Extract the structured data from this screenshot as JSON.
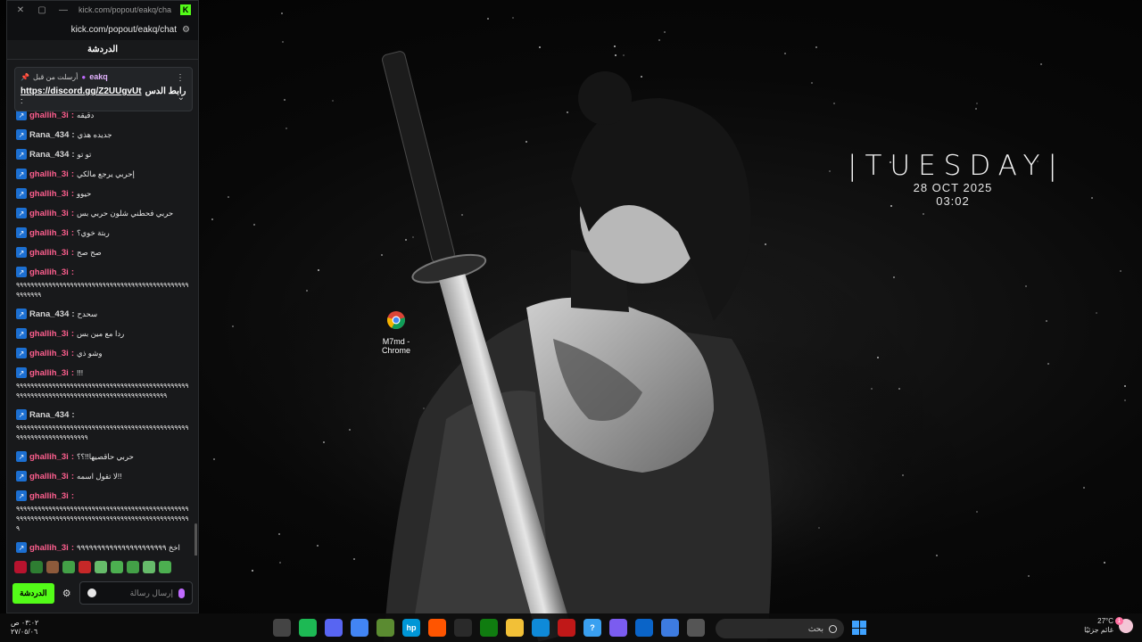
{
  "desktop": {
    "widget": {
      "day": "|TUESDAY|",
      "date": "28 OCT 2025",
      "time": "03:02"
    },
    "icon": {
      "label_line1": "M7md -",
      "label_line2": "Chrome",
      "icon": "chrome-icon"
    }
  },
  "chat_window": {
    "title_url": "kick.com/popout/eakq/chat",
    "address": "kick.com/popout/eakq/chat",
    "header": "الدردشة",
    "pinned": {
      "sent_by": "أرسلت من قبل",
      "author": "eakq",
      "link": "https://discord.gg/Z2UUgvUt",
      "text": "رابط الدس",
      "tail": ":"
    },
    "messages": [
      {
        "user": "ghallih_3i",
        "color": "pink",
        "text": "دقيقه"
      },
      {
        "user": "Rana_434",
        "color": "gray",
        "text": "جديده هذي"
      },
      {
        "user": "Rana_434",
        "color": "gray",
        "text": "تو تو"
      },
      {
        "user": "ghallih_3i",
        "color": "pink",
        "text": "إحربي يرجع مالكي"
      },
      {
        "user": "ghallih_3i",
        "color": "pink",
        "text": "حيوو"
      },
      {
        "user": "ghallih_3i",
        "color": "pink",
        "text": "حربي فحطني شلون حربي بس"
      },
      {
        "user": "ghallih_3i",
        "color": "pink",
        "text": "ربتة خوي؟"
      },
      {
        "user": "ghallih_3i",
        "color": "pink",
        "text": "صح صح"
      },
      {
        "user": "ghallih_3i",
        "color": "pink",
        "text": "",
        "long": "٩٩٩٩٩٩٩٩٩٩٩٩٩٩٩٩٩٩٩٩٩٩٩٩٩٩٩٩٩٩٩٩٩٩٩٩٩٩٩٩٩٩٩٩٩٩٩٩٩٩٩٩٩٩٩"
      },
      {
        "user": "Rana_434",
        "color": "gray",
        "text": "سحدح"
      },
      {
        "user": "ghallih_3i",
        "color": "pink",
        "text": "ردا مع مين بس"
      },
      {
        "user": "ghallih_3i",
        "color": "pink",
        "text": "وشو ذي"
      },
      {
        "user": "ghallih_3i",
        "color": "pink",
        "text": "!!!",
        "long": "٩٩٩٩٩٩٩٩٩٩٩٩٩٩٩٩٩٩٩٩٩٩٩٩٩٩٩٩٩٩٩٩٩٩٩٩٩٩٩٩٩٩٩٩٩٩٩٩٩٩٩٩٩٩٩٩٩٩٩٩٩٩٩٩٩٩٩٩٩٩٩٩٩٩٩٩٩٩٩٩٩٩٩٩٩٩٩٩٩٩"
      },
      {
        "user": "Rana_434",
        "color": "gray",
        "text": "",
        "long": "٩٩٩٩٩٩٩٩٩٩٩٩٩٩٩٩٩٩٩٩٩٩٩٩٩٩٩٩٩٩٩٩٩٩٩٩٩٩٩٩٩٩٩٩٩٩٩٩٩٩٩٩٩٩٩٩٩٩٩٩٩٩٩٩٩٩٩٩"
      },
      {
        "user": "ghallih_3i",
        "color": "pink",
        "text": "حربي حاقصيها!!؟؟"
      },
      {
        "user": "ghallih_3i",
        "color": "pink",
        "text": "لا تقول اسمه!!"
      },
      {
        "user": "ghallih_3i",
        "color": "pink",
        "text": "",
        "long": "٩٩٩٩٩٩٩٩٩٩٩٩٩٩٩٩٩٩٩٩٩٩٩٩٩٩٩٩٩٩٩٩٩٩٩٩٩٩٩٩٩٩٩٩٩٩٩٩٩٩٩٩٩٩٩٩٩٩٩٩٩٩٩٩٩٩٩٩٩٩٩٩٩٩٩٩٩٩٩٩٩٩٩٩٩٩٩٩٩٩٩٩٩٩٩٩٩"
      },
      {
        "user": "ghallih_3i",
        "color": "pink",
        "text": "اخخ ٩٩٩٩٩٩٩٩٩٩٩٩٩٩٩٩٩٩٩٩٩٩"
      }
    ],
    "input_placeholder": "إرسال رسالة",
    "send_label": "الدردشة"
  },
  "taskbar": {
    "time": "٠٣:٠٢ ص",
    "date": "٢٧/٠٥/٠٦",
    "search_placeholder": "بحث",
    "weather_temp": "27°C",
    "weather_desc": "غائم جزئيًا",
    "weather_badge": "1",
    "apps": [
      {
        "name": "settings-app",
        "color": "#444",
        "text": ""
      },
      {
        "name": "spotify-app",
        "color": "#1db954",
        "text": ""
      },
      {
        "name": "discord-app",
        "color": "#5865f2",
        "text": ""
      },
      {
        "name": "chrome-app",
        "color": "#4285f4",
        "text": ""
      },
      {
        "name": "minecraft-app",
        "color": "#5b8b31",
        "text": ""
      },
      {
        "name": "hp-app",
        "color": "#0096d6",
        "text": "hp"
      },
      {
        "name": "soundcloud-app",
        "color": "#ff5500",
        "text": ""
      },
      {
        "name": "steam-app",
        "color": "#2a2a2a",
        "text": ""
      },
      {
        "name": "xbox-app",
        "color": "#107c10",
        "text": ""
      },
      {
        "name": "file-explorer-app",
        "color": "#f2c037",
        "text": ""
      },
      {
        "name": "edge-app",
        "color": "#0f8ad8",
        "text": ""
      },
      {
        "name": "mcafee-app",
        "color": "#c01818",
        "text": ""
      },
      {
        "name": "help-app",
        "color": "#3aa0f0",
        "text": "?"
      },
      {
        "name": "copilot-app",
        "color": "#7b5cf0",
        "text": ""
      },
      {
        "name": "outlook-app",
        "color": "#0a64c8",
        "text": ""
      },
      {
        "name": "store-app",
        "color": "#3d7be0",
        "text": ""
      },
      {
        "name": "taskview-app",
        "color": "#555",
        "text": ""
      }
    ]
  },
  "colors": {
    "accent_kick": "#53fc18",
    "user_pink": "#ff5f8f",
    "badge_blue": "#1c6fd1",
    "windows_blue": "#3fa2ff"
  }
}
